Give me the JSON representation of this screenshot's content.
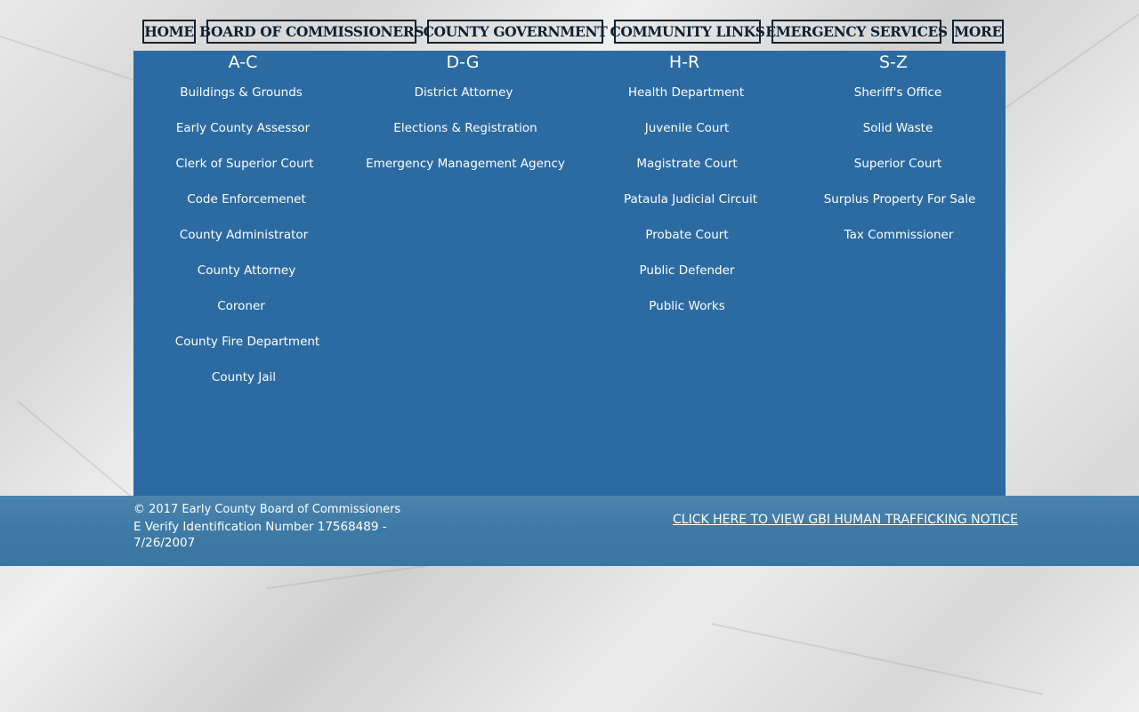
{
  "nav": {
    "home": "HOME",
    "board": "BOARD OF COMMISSIONERS",
    "county_government": "COUNTY GOVERNMENT",
    "community_links": "COMMUNITY LINKS",
    "emergency_services": "EMERGENCY SERVICES",
    "more": "MORE"
  },
  "columns": {
    "ac": {
      "heading": "A-C",
      "items": [
        "Buildings & Grounds",
        "Early County Assessor",
        "Clerk of Superior Court",
        "Code Enforcemenet",
        "County Administrator",
        "County Attorney",
        "Coroner",
        "County Fire Department",
        "County Jail"
      ]
    },
    "dg": {
      "heading": "D-G",
      "items": [
        "District Attorney",
        "Elections & Registration",
        "Emergency Management Agency"
      ]
    },
    "hr": {
      "heading": "H-R",
      "items": [
        "Health Department",
        "Juvenile Court",
        "Magistrate Court",
        "Pataula Judicial Circuit",
        "Probate Court",
        "Public Defender",
        "Public Works"
      ]
    },
    "sz": {
      "heading": "S-Z",
      "items": [
        "Sheriff's Office",
        "Solid Waste",
        "Superior Court",
        "Surplus Property For Sale",
        "Tax Commissioner"
      ]
    }
  },
  "footer": {
    "copyright": "© 2017 Early County Board of Commissioners",
    "everify": "E Verify Identification Number 17568489 - 7/26/2007",
    "gbi_link": "CLICK HERE TO VIEW GBI HUMAN TRAFFICKING NOTICE"
  },
  "colors": {
    "panel": "#2c6ba2",
    "footer": "#3e7aa6",
    "nav_border": "#0f2233",
    "text": "#ffffff"
  }
}
